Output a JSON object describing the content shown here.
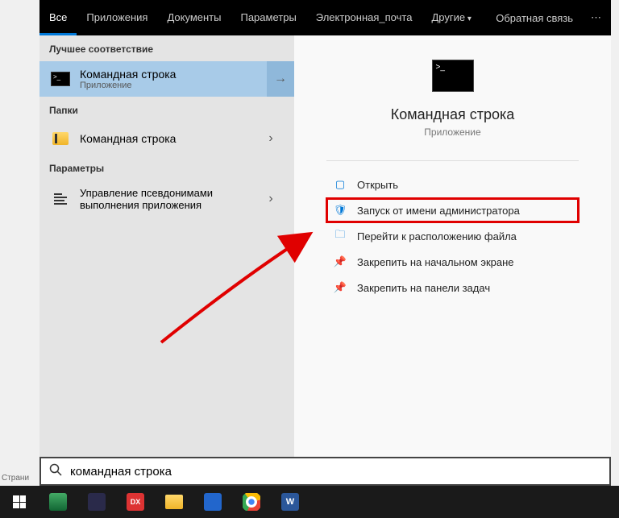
{
  "tabs": {
    "all": "Все",
    "apps": "Приложения",
    "docs": "Документы",
    "params": "Параметры",
    "email": "Электронная_почта",
    "other": "Другие",
    "feedback": "Обратная связь"
  },
  "sections": {
    "best_match": "Лучшее соответствие",
    "folders": "Папки",
    "parameters": "Параметры"
  },
  "results": {
    "cmd": {
      "title": "Командная строка",
      "sub": "Приложение"
    },
    "folder_cmd": "Командная строка",
    "alias": "Управление псевдонимами выполнения приложения"
  },
  "detail": {
    "title": "Командная строка",
    "type": "Приложение"
  },
  "actions": {
    "open": "Открыть",
    "run_admin": "Запуск от имени администратора",
    "goto_location": "Перейти к расположению файла",
    "pin_start": "Закрепить на начальном экране",
    "pin_taskbar": "Закрепить на панели задач"
  },
  "search": {
    "value": "командная строка"
  },
  "page_label": "Страни"
}
